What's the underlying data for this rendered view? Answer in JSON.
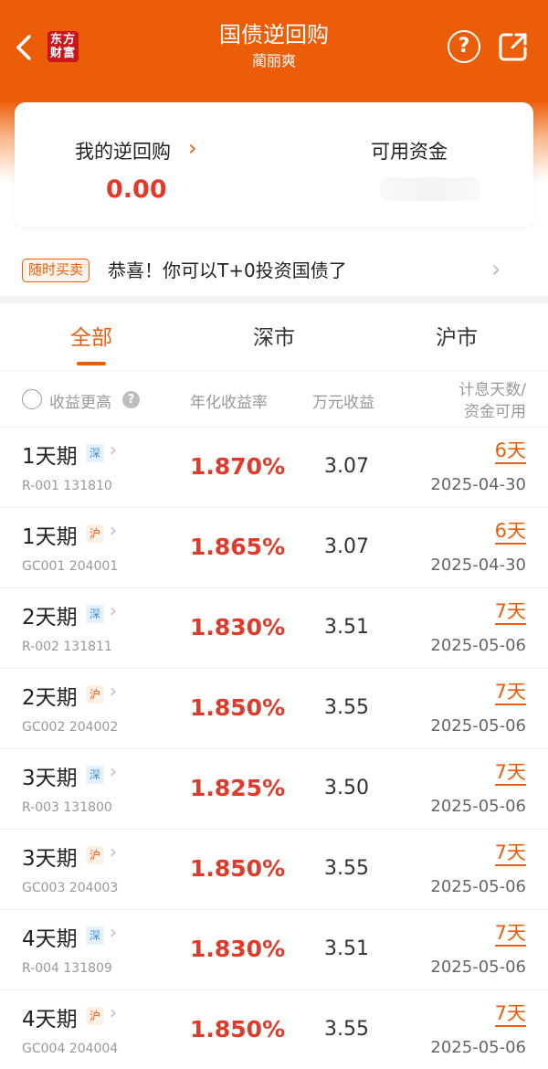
{
  "header": {
    "title": "国债逆回购",
    "subtitle": "蔺丽爽",
    "logo_line1": "东方",
    "logo_line2": "财富",
    "help_label": "?",
    "bg_color": "#ec5d0a"
  },
  "summary": {
    "my_repo_label": "我的逆回购",
    "my_repo_arrow": "›",
    "my_repo_value": "0.00",
    "available_funds_label": "可用资金"
  },
  "notice": {
    "tag": "随时买卖",
    "text": "恭喜！你可以T+0投资国债了",
    "arrow": "›"
  },
  "tabs": [
    {
      "label": "全部",
      "active": true
    },
    {
      "label": "深市",
      "active": false
    },
    {
      "label": "沪市",
      "active": false
    }
  ],
  "table_header": {
    "sort_label": "收益更高",
    "col_rate": "年化收益率",
    "col_income": "万元收益",
    "col_days_line1": "计息天数/",
    "col_days_line2": "资金可用"
  },
  "rows": [
    {
      "name": "1天期",
      "market": "深",
      "market_type": "sz",
      "code": "R-001 131810",
      "rate": "1.870%",
      "income": "3.07",
      "days": "6天",
      "date": "2025-04-30"
    },
    {
      "name": "1天期",
      "market": "沪",
      "market_type": "sh",
      "code": "GC001 204001",
      "rate": "1.865%",
      "income": "3.07",
      "days": "6天",
      "date": "2025-04-30"
    },
    {
      "name": "2天期",
      "market": "深",
      "market_type": "sz",
      "code": "R-002 131811",
      "rate": "1.830%",
      "income": "3.51",
      "days": "7天",
      "date": "2025-05-06"
    },
    {
      "name": "2天期",
      "market": "沪",
      "market_type": "sh",
      "code": "GC002 204002",
      "rate": "1.850%",
      "income": "3.55",
      "days": "7天",
      "date": "2025-05-06"
    },
    {
      "name": "3天期",
      "market": "深",
      "market_type": "sz",
      "code": "R-003 131800",
      "rate": "1.825%",
      "income": "3.50",
      "days": "7天",
      "date": "2025-05-06"
    },
    {
      "name": "3天期",
      "market": "沪",
      "market_type": "sh",
      "code": "GC003 204003",
      "rate": "1.850%",
      "income": "3.55",
      "days": "7天",
      "date": "2025-05-06"
    },
    {
      "name": "4天期",
      "market": "深",
      "market_type": "sz",
      "code": "R-004 131809",
      "rate": "1.830%",
      "income": "3.51",
      "days": "7天",
      "date": "2025-05-06"
    },
    {
      "name": "4天期",
      "market": "沪",
      "market_type": "sh",
      "code": "GC004 204004",
      "rate": "1.850%",
      "income": "3.55",
      "days": "7天",
      "date": "2025-05-06"
    }
  ]
}
